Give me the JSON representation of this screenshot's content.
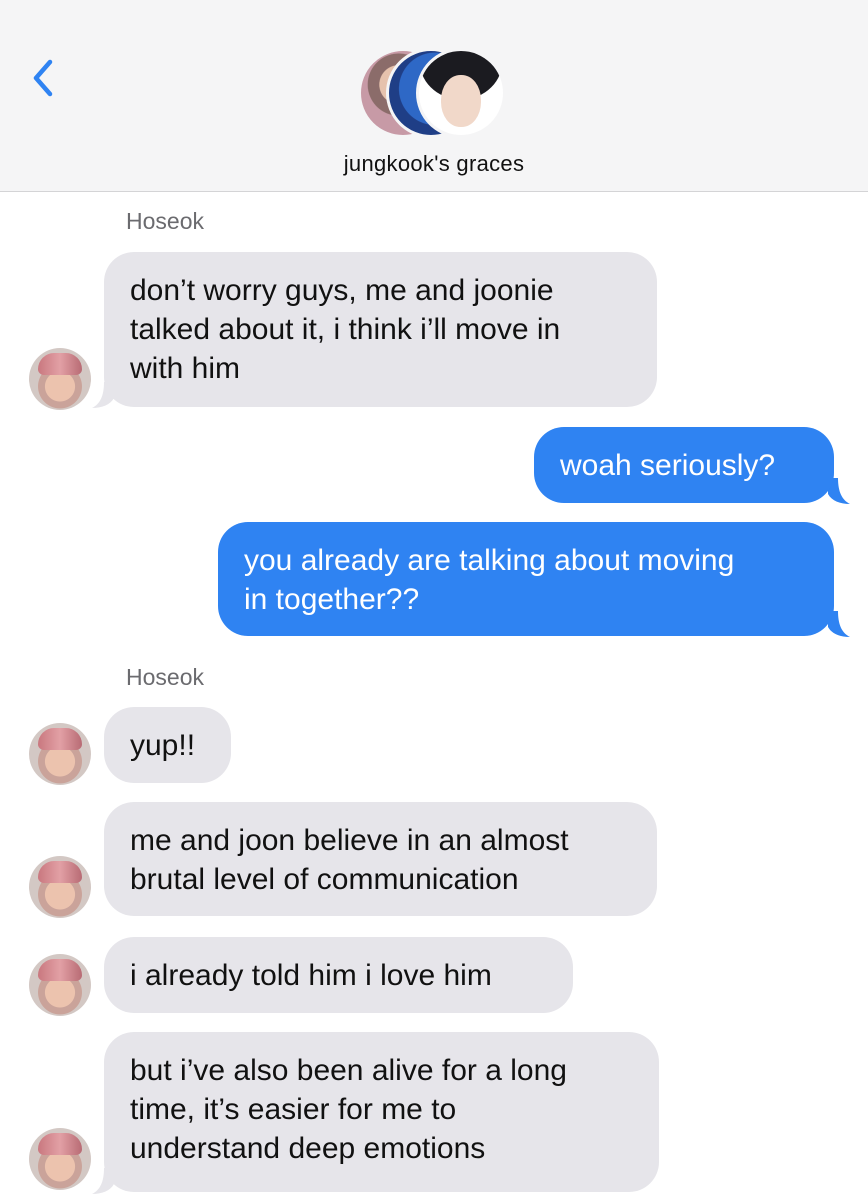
{
  "header": {
    "group_name": "jungkook's graces",
    "back_icon": "chevron-left-icon",
    "accent_color": "#2f83f2"
  },
  "messages": {
    "sender1": "Hoseok",
    "m1": "don’t worry guys, me and joonie\ntalked about it, i think i’ll move in\nwith him",
    "m2": "woah seriously?",
    "m3": "you already are talking about moving\nin together??",
    "sender2": "Hoseok",
    "m4": "yup!!",
    "m5": "me and joon believe in an almost\nbrutal level of communication",
    "m6": "i already told him i love him",
    "m7": "but i’ve also been alive for a long\ntime, it’s easier for me to\nunderstand deep emotions"
  },
  "colors": {
    "incoming_bubble": "#e6e5ea",
    "outgoing_bubble": "#2f83f2"
  }
}
